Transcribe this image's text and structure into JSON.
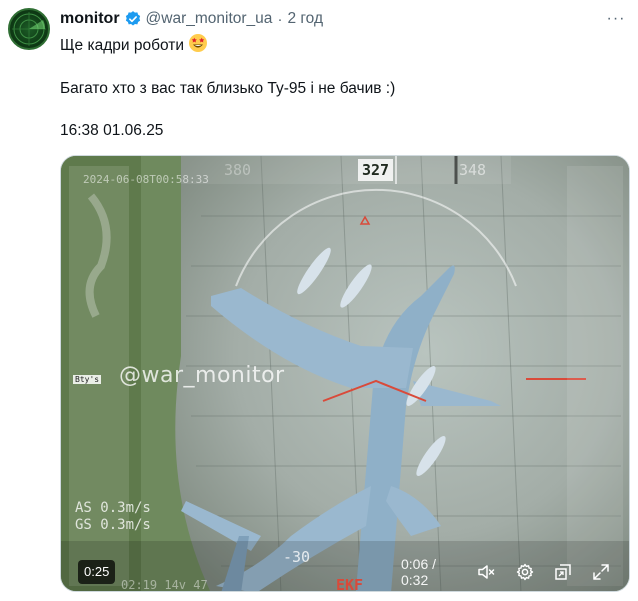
{
  "tweet": {
    "display_name": "monitor",
    "handle": "@war_monitor_ua",
    "separator": "·",
    "time_ago": "2 год",
    "more_label": "···",
    "line1": "Ще кадри роботи",
    "line1_emoji": "star-struck-emoji",
    "line2": "Багато хто з вас так близько Ту-95 і не бачив :)",
    "line3": "16:38 01.06.25"
  },
  "video": {
    "watermark": "@war_monitor",
    "duration_badge": "0:25",
    "timecode": "0:06 / 0:32",
    "hud": {
      "heading": "327",
      "left_heading": "380",
      "right_heading": "348",
      "date_stamp": "2024-06-08T00:58:33",
      "airspeed": "AS 0.3m/s",
      "groundspeed": "GS 0.3m/s",
      "pitch": "-30",
      "battery_tag": "Bty's",
      "mode": "EKF",
      "bottom_readout": "02:19  14v 47"
    },
    "icons": [
      "mute-icon",
      "settings-icon",
      "picture-in-picture-icon",
      "fullscreen-icon"
    ]
  },
  "colors": {
    "verified_blue": "#1d9bf0",
    "muted_text": "#536471",
    "hud_red": "#d94a3a"
  }
}
